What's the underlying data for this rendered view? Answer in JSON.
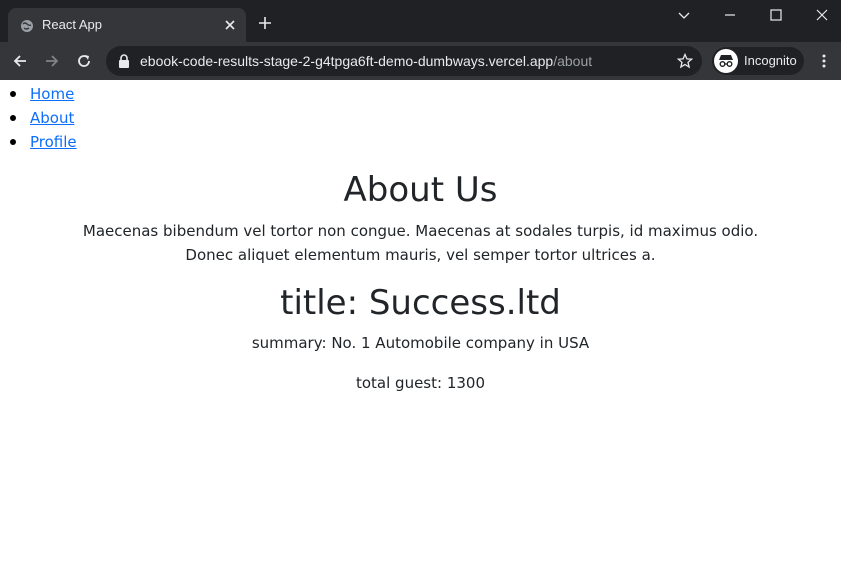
{
  "browser": {
    "tab_title": "React App",
    "url_host": "ebook-code-results-stage-2-g4tpga6ft-demo-dumbways.vercel.app",
    "url_path": "/about",
    "incognito_label": "Incognito"
  },
  "nav": {
    "items": [
      {
        "label": "Home"
      },
      {
        "label": "About"
      },
      {
        "label": "Profile"
      }
    ]
  },
  "about": {
    "title": "About Us",
    "text": "Maecenas bibendum vel tortor non congue. Maecenas at sodales turpis, id maximus odio. Donec aliquet elementum mauris, vel semper tortor ultrices a."
  },
  "company": {
    "title": "title: Success.ltd",
    "summary": "summary: No. 1 Automobile company in USA",
    "guests": "total guest: 1300"
  },
  "colors": {
    "link": "#0d6efd",
    "text": "#212529",
    "tabbar_bg": "#202124",
    "toolbar_bg": "#35363a"
  },
  "icons": [
    "globe-icon",
    "close-icon",
    "plus-icon",
    "chevron-down-icon",
    "minimize-icon",
    "maximize-icon",
    "back-arrow-icon",
    "forward-arrow-icon",
    "reload-icon",
    "lock-icon",
    "star-icon",
    "incognito-icon",
    "kebab-menu-icon"
  ]
}
